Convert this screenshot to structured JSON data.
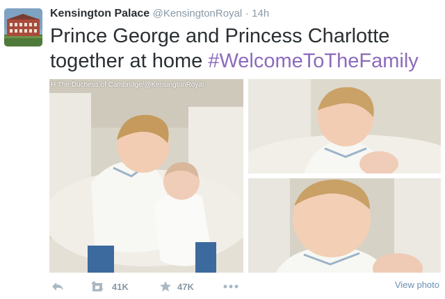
{
  "tweet": {
    "author_name": "Kensington Palace",
    "handle": "@KensingtonRoyal",
    "separator": "·",
    "time": "14h",
    "text": "Prince George and Princess Charlotte together at home",
    "hashtag": "#WelcomeToTheFamily"
  },
  "media": {
    "credit": "H The Duchess of Cambridge/@KensingtonRoyal"
  },
  "actions": {
    "reply_icon": "reply-icon",
    "retweet_icon": "retweet-icon",
    "retweet_count": "41K",
    "favorite_icon": "star-icon",
    "favorite_count": "47K",
    "more_icon": "more-dots-icon",
    "view_photo": "View photo"
  },
  "colors": {
    "hashtag": "#8c6abd",
    "meta_gray": "#8899a6",
    "link": "#6b8fb5",
    "text": "#292f33"
  }
}
